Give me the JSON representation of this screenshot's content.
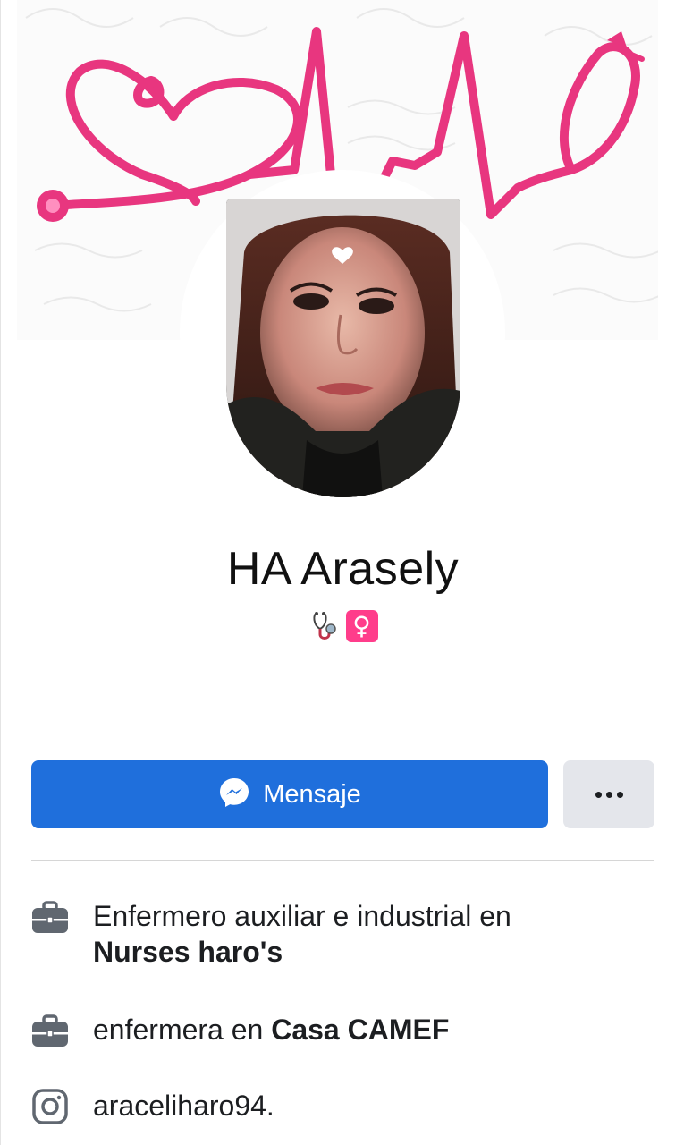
{
  "profile": {
    "name": "HA Arasely",
    "bio_emoji": "♀"
  },
  "actions": {
    "message_label": "Mensaje"
  },
  "info": [
    {
      "icon": "briefcase-icon",
      "prefix": "Enfermero auxiliar e industrial en",
      "bold": "Nurses haro's"
    },
    {
      "icon": "briefcase-icon",
      "prefix": "enfermera en",
      "bold": "Casa CAMEF"
    },
    {
      "icon": "instagram-icon",
      "text": "araceliharo94."
    }
  ],
  "colors": {
    "accent": "#1f6fdc",
    "cover_line": "#e8367f",
    "secondary_button": "#e4e6eb"
  }
}
